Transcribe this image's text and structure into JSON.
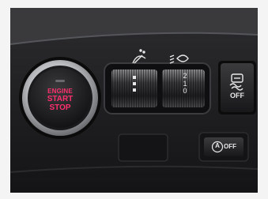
{
  "engine_button": {
    "line1": "ENGINE",
    "line2": "START",
    "line3": "STOP"
  },
  "wiper_dial": {
    "icon": "wiper-washer-icon"
  },
  "headlight_dial": {
    "icon": "headlight-level-icon",
    "markings": [
      "2",
      "1",
      "0"
    ]
  },
  "traction_button": {
    "icon": "traction-control-icon",
    "label": "OFF"
  },
  "auto_stop_button": {
    "letter": "A",
    "label": "OFF"
  },
  "colors": {
    "engine_text": "#ff2f6d",
    "panel": "#1e1e20",
    "chrome": "#cfd1d4",
    "label_white": "#e9e9e9"
  }
}
